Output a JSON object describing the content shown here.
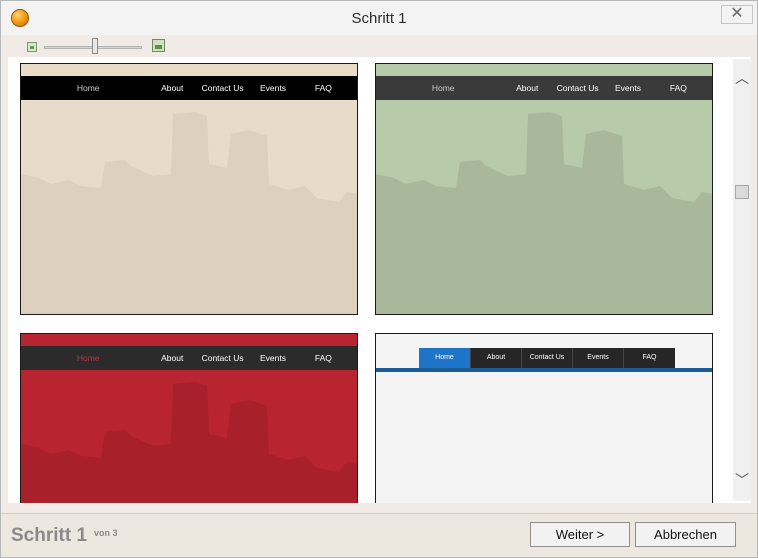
{
  "window": {
    "title": "Schritt 1",
    "close_glyph": "✕"
  },
  "toolbar": {
    "zoom_small_icon": "image-small-icon",
    "zoom_large_icon": "image-large-icon",
    "zoom_level": 0.55
  },
  "templates": [
    {
      "background": "#e8dcc8",
      "skyline_color": "#ddd0bc",
      "nav_bg": "#000000",
      "accent": "#e8dcc8",
      "nav": [
        "Home",
        "About",
        "Contact Us",
        "Events",
        "FAQ"
      ],
      "nav_colors": [
        "#cfcfcf",
        "#ffffff",
        "#ffffff",
        "#ffffff",
        "#ffffff"
      ]
    },
    {
      "background": "#b7cbaa",
      "skyline_color": "#a9b89b",
      "nav_bg": "#3a3a3a",
      "accent": "#b7cbaa",
      "nav": [
        "Home",
        "About",
        "Contact Us",
        "Events",
        "FAQ"
      ],
      "nav_colors": [
        "#c8c8c8",
        "#ffffff",
        "#ffffff",
        "#ffffff",
        "#ffffff"
      ]
    },
    {
      "background": "#b8242f",
      "skyline_color": "#a7202a",
      "nav_bg": "#2b2b2b",
      "accent": "#b8242f",
      "nav": [
        "Home",
        "About",
        "Contact Us",
        "Events",
        "FAQ"
      ],
      "nav_colors": [
        "#c0323c",
        "#ffffff",
        "#ffffff",
        "#ffffff",
        "#ffffff"
      ]
    },
    {
      "background": "#f4f4f4",
      "nav_bg": "#262626",
      "active_bg": "#1e74c9",
      "stripe": "#1d5d96",
      "nav": [
        "Home",
        "About",
        "Contact Us",
        "Events",
        "FAQ"
      ]
    }
  ],
  "scrollbar": {
    "up": "︿",
    "down": "﹀"
  },
  "footer": {
    "step": "Schritt 1",
    "of": "von 3",
    "next": "Weiter >",
    "cancel": "Abbrechen"
  }
}
